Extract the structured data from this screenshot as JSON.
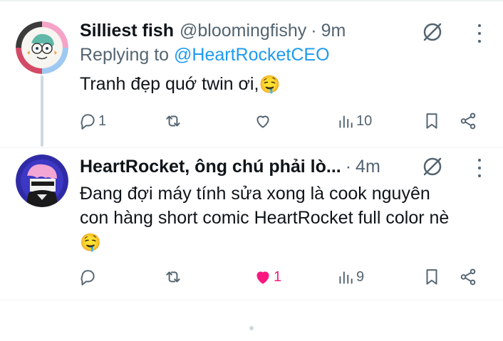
{
  "tweets": [
    {
      "author_name": "Silliest fish",
      "handle": "@bloomingfishy",
      "separator": "·",
      "time": "9m",
      "reply_prefix": "Replying to",
      "reply_mention": "@HeartRocketCEO",
      "text": "Tranh đẹp quớ twin ơi,",
      "emoji": "🤤",
      "actions": {
        "reply_count": "1",
        "retweet_count": "",
        "like_count": "",
        "views_count": "10"
      },
      "liked": false
    },
    {
      "author_name": "HeartRocket, ông chú phải lò...",
      "separator": "·",
      "time": "4m",
      "text": "Đang đợi máy tính sửa xong là cook nguyên con hàng short comic HeartRocket full color nè",
      "emoji": "🤤",
      "actions": {
        "reply_count": "",
        "retweet_count": "",
        "like_count": "1",
        "views_count": "9"
      },
      "liked": true
    }
  ],
  "icons": {
    "reply": "reply-icon",
    "retweet": "retweet-icon",
    "like": "heart-icon",
    "views": "views-chart-icon",
    "bookmark": "bookmark-icon",
    "share": "share-icon",
    "grok": "grok-icon",
    "more": "more-icon"
  },
  "colors": {
    "primary_text": "#0f1419",
    "secondary_text": "#536471",
    "link": "#1d9bf0",
    "like_active": "#f91880",
    "divider": "#eff3f4",
    "thread_line": "#cfd9de"
  }
}
